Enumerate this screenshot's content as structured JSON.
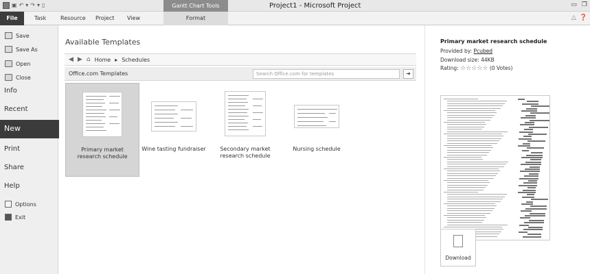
{
  "window": {
    "title": "Project1 - Microsoft Project",
    "context_tab": "Gantt Chart Tools"
  },
  "quick_access": {
    "icons": [
      "app-icon",
      "save-icon",
      "undo-icon",
      "redo-icon",
      "new-icon"
    ],
    "labels": [
      "▾",
      "▾"
    ]
  },
  "ribbon": {
    "file": "File",
    "tabs": [
      "Task",
      "Resource",
      "Project",
      "View"
    ],
    "format": "Format"
  },
  "nav": {
    "save": "Save",
    "save_as": "Save As",
    "open": "Open",
    "close": "Close",
    "info": "Info",
    "recent": "Recent",
    "new": "New",
    "print": "Print",
    "share": "Share",
    "help": "Help",
    "options": "Options",
    "exit": "Exit"
  },
  "main": {
    "title": "Available Templates",
    "breadcrumb": {
      "home": "Home",
      "separator": "▸",
      "current": "Schedules"
    },
    "section": "Office.com Templates",
    "search_placeholder": "Search Office.com for templates",
    "templates": [
      {
        "name": "Primary market research schedule",
        "selected": true
      },
      {
        "name": "Wine tasting fundraiser",
        "selected": false
      },
      {
        "name": "Secondary market research schedule",
        "selected": false
      },
      {
        "name": "Nursing schedule",
        "selected": false
      }
    ]
  },
  "preview": {
    "title": "Primary market research schedule",
    "provided_label": "Provided by:",
    "provided_by": "Pcubed",
    "size_label": "Download size:",
    "size": "44KB",
    "rating_label": "Rating:",
    "stars": "☆☆☆☆☆",
    "votes": "(0 Votes)",
    "download": "Download"
  },
  "colors": {
    "file_tab": "#3c3c3c",
    "selected_tile": "#d5d5d5",
    "context_tab": "#8c8c8c"
  }
}
